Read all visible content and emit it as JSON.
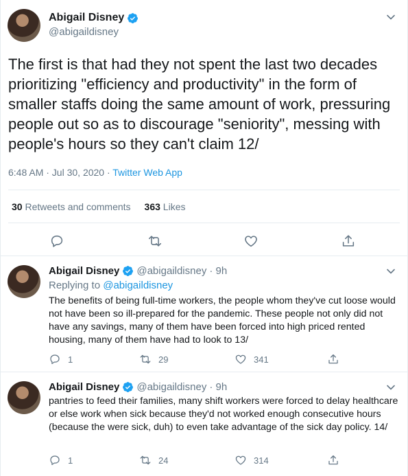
{
  "main_tweet": {
    "author_name": "Abigail Disney",
    "author_handle": "@abigaildisney",
    "text": "The first is that had they not spent the last two decades prioritizing \"efficiency and productivity\" in the form of smaller staffs doing the same amount of work, pressuring people out so as to discourage \"seniority\", messing with people's hours so they can't claim 12/",
    "timestamp": "6:48 AM · Jul 30, 2020 · ",
    "app": "Twitter Web App",
    "retweets_count": "30",
    "retweets_label": "Retweets and comments",
    "likes_count": "363",
    "likes_label": "Likes"
  },
  "replies": [
    {
      "author_name": "Abigail Disney",
      "author_handle": "@abigaildisney",
      "time": "· 9h",
      "replying_label": "Replying to ",
      "replying_handle": "@abigaildisney",
      "text": "The benefits of being full-time workers, the people whom they've cut loose would not have been so ill-prepared for the pandemic. These people not only did not have any savings, many of them have been forced into high priced rented housing, many of them have had to look to 13/",
      "reply_count": "1",
      "retweet_count": "29",
      "like_count": "341"
    },
    {
      "author_name": "Abigail Disney",
      "author_handle": "@abigaildisney",
      "time": "· 9h",
      "text": "pantries to feed their families, many shift workers were forced to delay healthcare or else work when sick because they'd not worked enough consecutive hours (because the were sick, duh) to even take advantage of the sick day policy. 14/",
      "reply_count": "1",
      "retweet_count": "24",
      "like_count": "314"
    }
  ],
  "colors": {
    "accent": "#1b95e0",
    "secondary_text": "#657786",
    "primary_text": "#14171a",
    "border": "#e6ecf0"
  },
  "icons": [
    "verified-icon",
    "chevron-down-icon",
    "reply-icon",
    "retweet-icon",
    "like-icon",
    "share-icon"
  ]
}
